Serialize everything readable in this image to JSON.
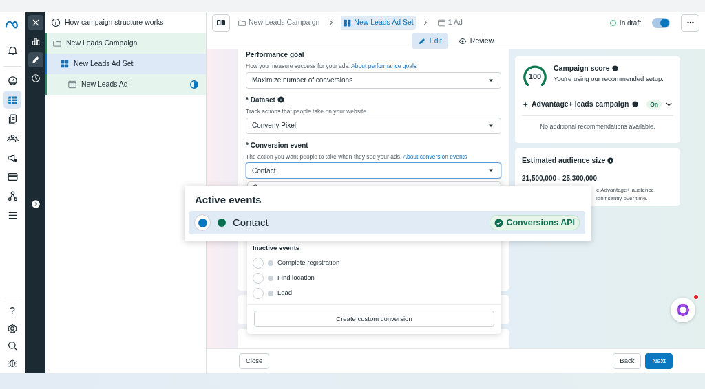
{
  "rail": {
    "items": [
      {
        "kind": "bell",
        "selected": false
      },
      {
        "kind": "gauge",
        "selected": false
      },
      {
        "kind": "table",
        "selected": true
      },
      {
        "kind": "docs",
        "selected": false
      },
      {
        "kind": "people",
        "selected": false
      },
      {
        "kind": "megaphone",
        "selected": false
      },
      {
        "kind": "card",
        "selected": false
      },
      {
        "kind": "network",
        "selected": false
      },
      {
        "kind": "menu",
        "selected": false
      }
    ],
    "bottom": [
      {
        "kind": "help",
        "label": "?"
      },
      {
        "kind": "settings"
      },
      {
        "kind": "search"
      },
      {
        "kind": "bug"
      }
    ]
  },
  "toolstrip": {
    "items": [
      {
        "kind": "chart",
        "selected": false
      },
      {
        "kind": "edit",
        "selected": true
      },
      {
        "kind": "history",
        "selected": false
      }
    ]
  },
  "tree": {
    "header": "How campaign structure works",
    "items": [
      {
        "label": "New Leads Campaign",
        "kind": "campaign",
        "selected": false,
        "children": [
          {
            "label": "New Leads Ad Set",
            "kind": "adset",
            "selected": true,
            "children": [
              {
                "label": "New Leads Ad",
                "kind": "ad",
                "selected": false,
                "in_progress": true
              }
            ]
          }
        ]
      }
    ]
  },
  "breadcrumb": [
    {
      "label": "New Leads Campaign",
      "kind": "campaign",
      "selected": false
    },
    {
      "label": "New Leads Ad Set",
      "kind": "adset",
      "selected": true
    },
    {
      "label": "1 Ad",
      "kind": "ad",
      "selected": false
    }
  ],
  "status": {
    "label": "In draft",
    "on": true
  },
  "view_tabs": [
    {
      "label": "Edit",
      "kind": "edit",
      "selected": true
    },
    {
      "label": "Review",
      "kind": "review",
      "selected": false
    }
  ],
  "form": {
    "fields": [
      {
        "label": "Performance goal",
        "help": "How you measure success for your ads.",
        "link": "About performance goals",
        "value": "Maximize number of conversions"
      },
      {
        "label": "* Dataset",
        "info": true,
        "help": "Track actions that people take on your website.",
        "value": "Converly Pixel"
      },
      {
        "label": "* Conversion event",
        "help": "The action you want people to take when they see your ads.",
        "link": "About conversion events",
        "value": "Contact",
        "focused": true
      }
    ]
  },
  "dropdown": {
    "inactive_title": "Inactive events",
    "options": [
      {
        "label": "Complete registration",
        "selected": false,
        "color": "#cbd2d9"
      },
      {
        "label": "Find location",
        "selected": false,
        "color": "#cbd2d9"
      },
      {
        "label": "Lead",
        "selected": false,
        "color": "#cbd2d9"
      }
    ],
    "button": "Create custom conversion"
  },
  "popup": {
    "title": "Active events",
    "options": [
      {
        "label": "Contact",
        "selected": true,
        "color": "#0b6e4f",
        "badge": "Conversions API"
      }
    ]
  },
  "score": {
    "value": "100",
    "title": "Campaign score",
    "subtitle": "You're using our recommended setup.",
    "advantage": "Advantage+ leads campaign",
    "badge": "On",
    "expanded": false,
    "note": "No additional recommendations available."
  },
  "audience": {
    "title": "Estimated audience size",
    "range": "21,500,000 - 25,300,000",
    "note_lines": [
      "e Advantage+ audience",
      "ignificantly over time."
    ]
  },
  "footer": [
    {
      "label": "Close",
      "kind": "dismiss"
    },
    {
      "label": "Back",
      "kind": "back"
    },
    {
      "label": "Next",
      "kind": "primary"
    }
  ]
}
